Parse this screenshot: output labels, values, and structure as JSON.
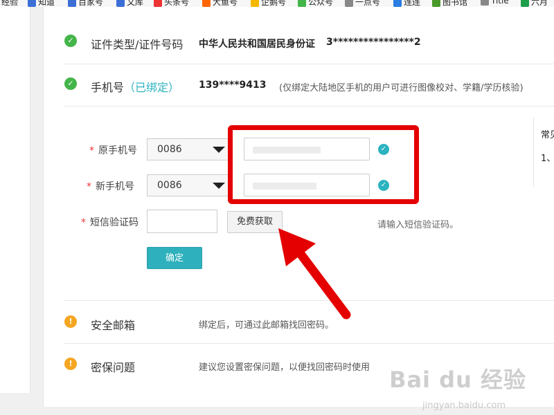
{
  "bookmarks": [
    "经验",
    "知道",
    "百家号",
    "文库",
    "头条号",
    "大鱼号",
    "企鹅号",
    "公众号",
    "一点号",
    "连连",
    "图书馆",
    "Title",
    "六月"
  ],
  "verified_rows": [
    {
      "label": "证件类型/证件号码",
      "value": "中华人民共和国居民身份证",
      "value2": "3****************2"
    },
    {
      "label": "手机号",
      "tag": "（已绑定）",
      "value": "139****9413",
      "hint": "(仅绑定大陆地区手机的用户可进行图像校对、学籍/学历核验)"
    }
  ],
  "form": {
    "old_phone_label": "原手机号",
    "new_phone_label": "新手机号",
    "sms_label": "短信验证码",
    "required_mark": "*",
    "country_code_old": "0086",
    "country_code_new": "0086",
    "get_code_button": "免费获取",
    "sms_hint": "请输入短信验证码。",
    "confirm_button": "确定"
  },
  "unverified_rows": [
    {
      "label": "安全邮箱",
      "hint": "绑定后，可通过此邮箱找回密码。"
    },
    {
      "label": "密保问题",
      "hint": "建议您设置密保问题，以便找回密码时使用"
    }
  ],
  "faq": {
    "title": "常见",
    "item1": "1、"
  },
  "watermark": {
    "text": "Bai du 经验",
    "sub": "jingyan.baidu.com"
  },
  "colors": {
    "accent": "#2eb1bc",
    "ok": "#44b549",
    "warn": "#f5a623",
    "annotation": "#e40000",
    "required": "#e33333"
  }
}
